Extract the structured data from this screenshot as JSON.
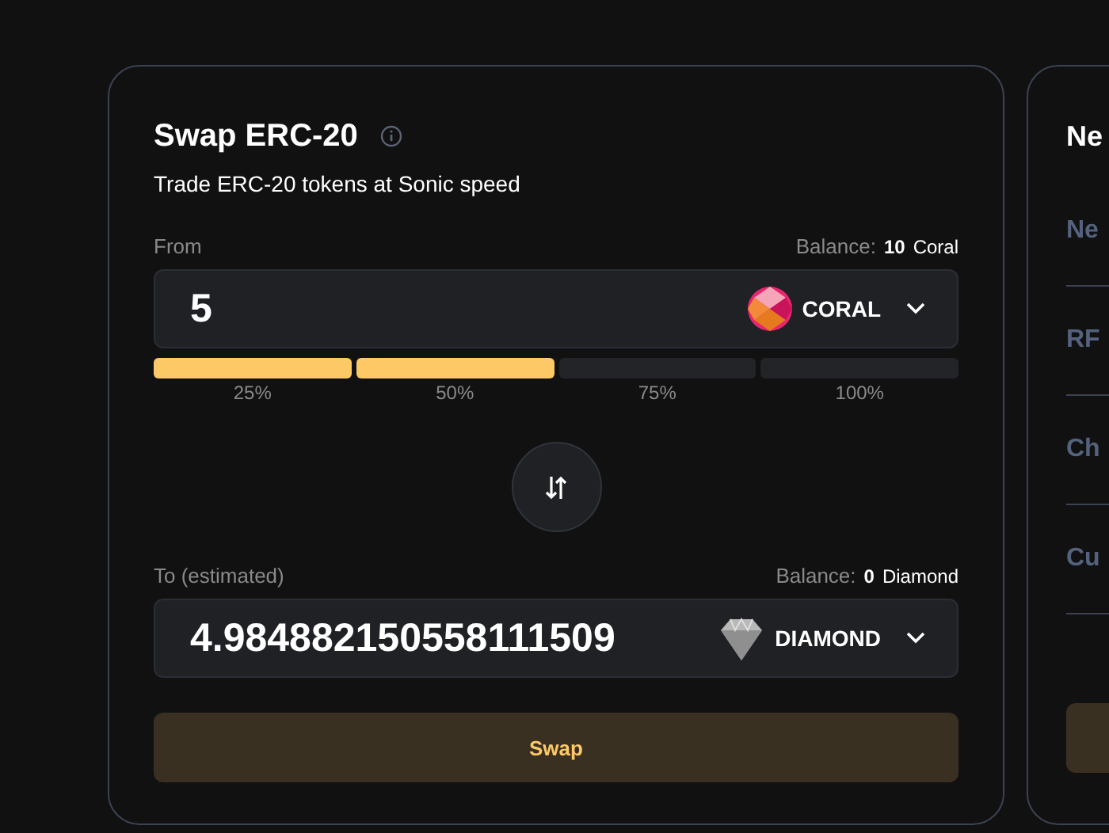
{
  "swap_card": {
    "title": "Swap ERC-20",
    "subtitle": "Trade ERC-20 tokens at Sonic speed",
    "from": {
      "label": "From",
      "balance_label": "Balance:",
      "balance_amount": "10",
      "balance_unit": "Coral",
      "value": "5",
      "token": "CORAL"
    },
    "percent_buttons": [
      {
        "label": "25%",
        "filled": true
      },
      {
        "label": "50%",
        "filled": true
      },
      {
        "label": "75%",
        "filled": false
      },
      {
        "label": "100%",
        "filled": false
      }
    ],
    "to": {
      "label": "To (estimated)",
      "balance_label": "Balance:",
      "balance_amount": "0",
      "balance_unit": "Diamond",
      "value": "4.984882150558111509",
      "token": "DIAMOND"
    },
    "swap_button": "Swap"
  },
  "side_card": {
    "title": "Ne",
    "items": [
      "Ne",
      "RF",
      "Ch",
      "Cu"
    ]
  }
}
